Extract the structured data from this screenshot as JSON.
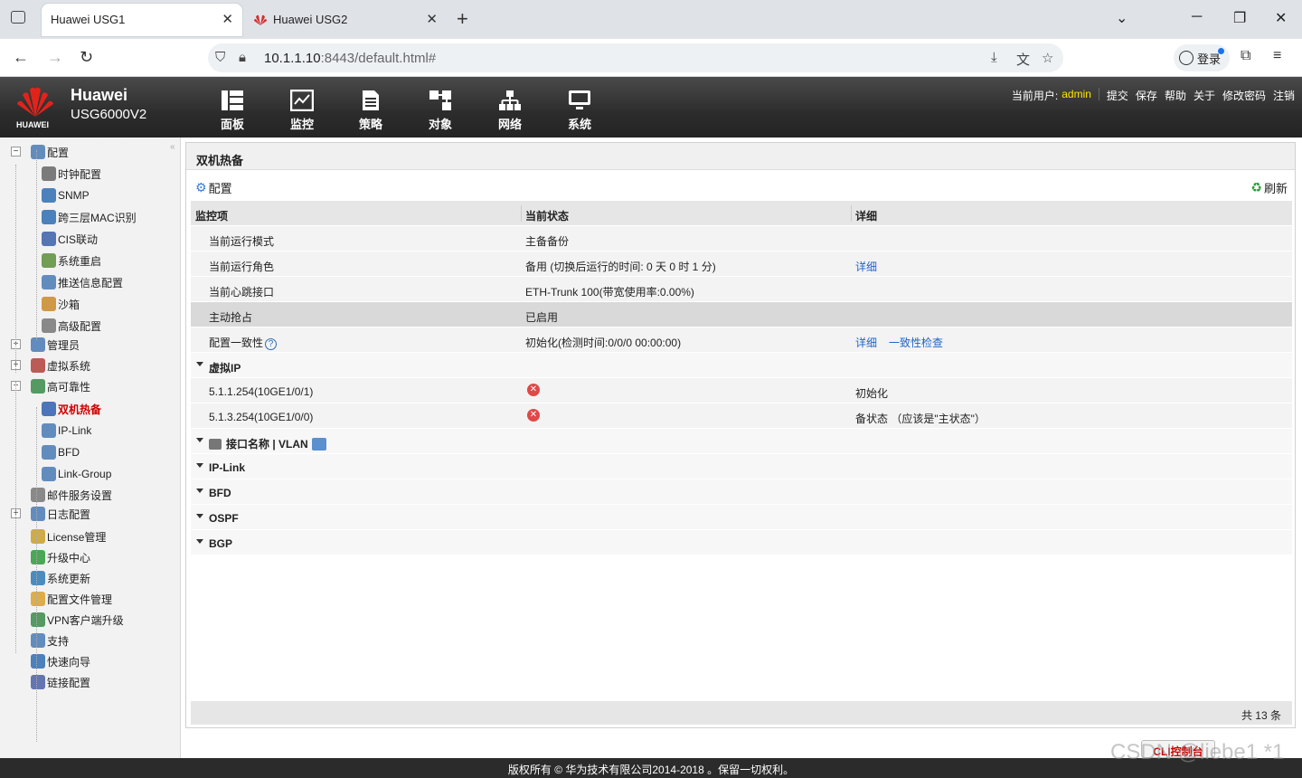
{
  "browser": {
    "tabs": [
      {
        "title": "Huawei USG1",
        "active": true
      },
      {
        "title": "Huawei USG2",
        "active": false
      }
    ],
    "url_host": "10.1.1.10",
    "url_rest": ":8443/default.html#",
    "login_label": "登录"
  },
  "header": {
    "brand_name": "Huawei",
    "model": "USG6000V2",
    "logo_text": "HUAWEI",
    "nav": [
      {
        "label": "面板",
        "icon": "dashboard-icon"
      },
      {
        "label": "监控",
        "icon": "monitor-icon"
      },
      {
        "label": "策略",
        "icon": "policy-icon"
      },
      {
        "label": "对象",
        "icon": "object-icon"
      },
      {
        "label": "网络",
        "icon": "network-icon"
      },
      {
        "label": "系统",
        "icon": "system-icon"
      }
    ],
    "current_user_label": "当前用户:",
    "current_user": "admin",
    "links": [
      "提交",
      "保存",
      "帮助",
      "关于",
      "修改密码",
      "注销"
    ]
  },
  "sidebar": {
    "items": [
      {
        "label": "配置",
        "level": 0,
        "expander": "−",
        "icon": "config-icon"
      },
      {
        "label": "时钟配置",
        "level": 1,
        "icon": "clock-icon"
      },
      {
        "label": "SNMP",
        "level": 1,
        "icon": "snmp-icon"
      },
      {
        "label": "跨三层MAC识别",
        "level": 1,
        "icon": "mac-icon"
      },
      {
        "label": "CIS联动",
        "level": 1,
        "icon": "cis-icon"
      },
      {
        "label": "系统重启",
        "level": 1,
        "icon": "restart-icon"
      },
      {
        "label": "推送信息配置",
        "level": 1,
        "icon": "push-icon"
      },
      {
        "label": "沙箱",
        "level": 1,
        "icon": "sandbox-icon"
      },
      {
        "label": "高级配置",
        "level": 1,
        "icon": "advanced-icon"
      },
      {
        "label": "管理员",
        "level": 0,
        "expander": "+",
        "icon": "admin-icon"
      },
      {
        "label": "虚拟系统",
        "level": 0,
        "expander": "+",
        "icon": "vsys-icon"
      },
      {
        "label": "高可靠性",
        "level": 0,
        "expander": "−",
        "icon": "ha-icon"
      },
      {
        "label": "双机热备",
        "level": 1,
        "icon": "hotstandby-icon",
        "selected": true
      },
      {
        "label": "IP-Link",
        "level": 1,
        "icon": "iplink-icon"
      },
      {
        "label": "BFD",
        "level": 1,
        "icon": "bfd-icon"
      },
      {
        "label": "Link-Group",
        "level": 1,
        "icon": "linkgroup-icon"
      },
      {
        "label": "邮件服务设置",
        "level": 0,
        "icon": "mail-icon"
      },
      {
        "label": "日志配置",
        "level": 0,
        "expander": "+",
        "icon": "log-icon"
      },
      {
        "label": "License管理",
        "level": 0,
        "icon": "license-icon"
      },
      {
        "label": "升级中心",
        "level": 0,
        "icon": "upgrade-icon"
      },
      {
        "label": "系统更新",
        "level": 0,
        "icon": "update-icon"
      },
      {
        "label": "配置文件管理",
        "level": 0,
        "icon": "configfile-icon"
      },
      {
        "label": "VPN客户端升级",
        "level": 0,
        "icon": "vpn-icon"
      },
      {
        "label": "支持",
        "level": 0,
        "icon": "support-icon"
      },
      {
        "label": "快速向导",
        "level": 0,
        "icon": "wizard-icon"
      },
      {
        "label": "链接配置",
        "level": 0,
        "icon": "link-icon"
      }
    ]
  },
  "panel": {
    "title": "双机热备",
    "config_label": "配置",
    "refresh_label": "刷新",
    "columns": [
      "监控项",
      "当前状态",
      "详细"
    ],
    "rows": [
      {
        "item": "当前运行模式",
        "status": "主备备份",
        "detail": ""
      },
      {
        "item": "当前运行角色",
        "status": "备用 (切换后运行的时间: 0 天 0 时 1 分)",
        "detail": "详细",
        "detail_link": true
      },
      {
        "item": "当前心跳接口",
        "status": "ETH-Trunk 100(带宽使用率:0.00%)",
        "detail": ""
      },
      {
        "item": "主动抢占",
        "status": "已启用",
        "detail": "",
        "highlight": true
      },
      {
        "item": "配置一致性",
        "status": "初始化(检测时间:0/0/0 00:00:00)",
        "detail": "详细",
        "detail_link": true,
        "extra_link": "一致性检查",
        "help": true
      }
    ],
    "vip_group": "虚拟IP",
    "vip_rows": [
      {
        "item": "5.1.1.254(10GE1/0/1)",
        "status_icon": "error",
        "detail": "初始化"
      },
      {
        "item": "5.1.3.254(10GE1/0/0)",
        "status_icon": "error",
        "detail": "备状态 （应该是\"主状态\"）"
      }
    ],
    "groups": [
      "接口名称 | VLAN",
      "IP-Link",
      "BFD",
      "OSPF",
      "BGP"
    ],
    "total": "共 13 条"
  },
  "footer": {
    "copyright": "版权所有 © 华为技术有限公司2014-2018 。保留一切权利。",
    "cli_label": "CLI控制台",
    "watermark": "CSDN @liebe1 *1"
  }
}
